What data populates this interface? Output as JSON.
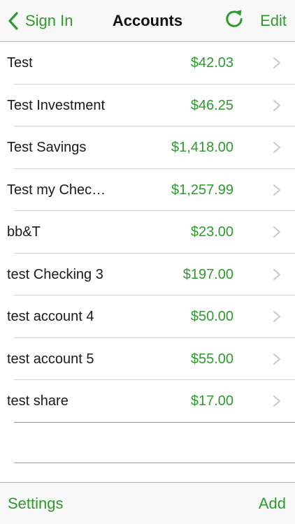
{
  "navbar": {
    "back_label": "Sign In",
    "title": "Accounts",
    "edit_label": "Edit",
    "refresh_icon": "refresh-icon",
    "back_icon": "chevron-left-icon"
  },
  "accounts": [
    {
      "name": "Test",
      "amount": "$42.03"
    },
    {
      "name": "Test Investment",
      "amount": "$46.25"
    },
    {
      "name": "Test Savings",
      "amount": "$1,418.00"
    },
    {
      "name": "Test my Chec…",
      "amount": "$1,257.99"
    },
    {
      "name": "bb&T",
      "amount": "$23.00"
    },
    {
      "name": "test Checking 3",
      "amount": "$197.00"
    },
    {
      "name": "test account 4",
      "amount": "$50.00"
    },
    {
      "name": "test account 5",
      "amount": "$55.00"
    },
    {
      "name": "test share",
      "amount": "$17.00"
    }
  ],
  "toolbar": {
    "settings_label": "Settings",
    "add_label": "Add"
  },
  "colors": {
    "accent": "#2e9a2e",
    "text": "#1a1a1a",
    "bar_background": "#f8f8f8",
    "separator": "#d4d4d4",
    "disclosure": "#c7c7cc"
  }
}
